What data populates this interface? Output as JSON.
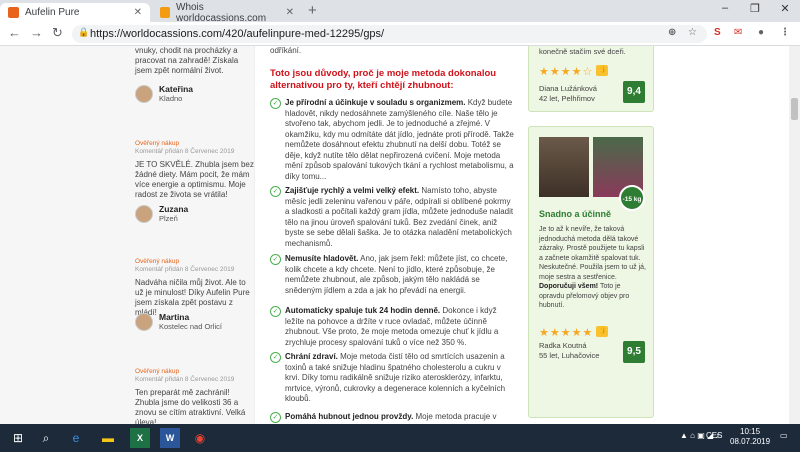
{
  "browser": {
    "tabs": [
      {
        "label": "Aufelin Pure",
        "active": true
      },
      {
        "label": "Whois worldocassions.com",
        "active": false
      }
    ],
    "url": "https://worldocassions.com/420/aufelinpure-med-12295/gps/"
  },
  "left_reviews": {
    "top_text": "vnuky, chodit na procházky a pracovat na zahradě! Získala jsem zpět normální život.",
    "p1_name": "Kateřina",
    "p1_city": "Kladno",
    "r2_meta": "Ověřený nákup",
    "r2_date": "Komentář přidán 8 Červenec 2019",
    "r2_text": "JE TO SKVĚLÉ. Zhubla jsem bez žádné diety. Mám pocit, že mám více energie a optimismu. Moje radost ze života se vrátila!",
    "p2_name": "Zuzana",
    "p2_city": "Plzeň",
    "r3_meta": "Ověřený nákup",
    "r3_date": "Komentář přidán 8 Červenec 2019",
    "r3_text": "Nadváha ničila můj život. Ale to už je minulost! Díky Aufelin Pure jsem získala zpět postavu z mládí!",
    "p3_name": "Martina",
    "p3_city": "Kostelec nad Orlicí",
    "r4_meta": "Ověřený nákup",
    "r4_date": "Komentář přidán 8 Červenec 2019",
    "r4_text": "Ten preparát mě zachránil! Zhubla jsme do velikosti 36 a znovu se cítím atraktivní. Velká úleva!"
  },
  "center": {
    "top_text": "odříkání.",
    "heading": "Toto jsou důvody, proč je moje metoda dokonalou alternativou pro ty, kteří chtějí zhubnout:",
    "items": [
      {
        "bold": "Je přírodní a účinkuje v souladu s organizmem.",
        "text": " Když budete hladovět, nikdy nedosáhnete zamýšleného cíle. Naše tělo je stvořeno tak, abychom jedli. Je to jednoduché a zřejmé. V okamžiku, kdy mu odmítáte dát jídlo, jednáte proti přírodě. Takže nemůžete dosáhnout efektu zhubnutí na delší dobu. Totéž se děje, když nutíte tělo dělat nepřirozená cvičení. Moje metoda mění způsob spalování tukových tkání a rychlost metabolismu, a díky tomu..."
      },
      {
        "bold": "Zajišťuje rychlý a velmi velký efekt.",
        "text": " Namísto toho, abyste měsíc jedli zeleninu vařenou v páře, odpírali si oblíbené pokrmy a sladkosti a počítali každý gram jídla, můžete jednoduše naladit tělo na jinou úroveň spalování tuků. Bez zvedání činek, aniž byste se sebe dělali šaška. Je to otázka naladění metabolických mechanismů."
      },
      {
        "bold": "Nemusíte hladovět.",
        "text": " Ano, jak jsem řekl: můžete jíst, co chcete, kolik chcete a kdy chcete. Není to jídlo, které způsobuje, že nemůžete zhubnout, ale způsob, jakým tělo nakládá se snědeným jídlem a zda a jak ho převádí na energii."
      },
      {
        "bold": "Automaticky spaluje tuk 24 hodin denně.",
        "text": " Dokonce i když ležíte na pohovce a držíte v ruce ovladač, můžete účinně zhubnout. Vše proto, že moje metoda omezuje chuť k jídlu a zrychluje procesy spalování tuků o více než 350 %."
      },
      {
        "bold": "Chrání zdraví.",
        "text": " Moje metoda čistí tělo od smrtících usazenin a toxinů a také snižuje hladinu špatného cholesterolu a cukru v krvi. Díky tomu radikálně snižuje riziko aterosklerózy, infarktu, mrtvice, výronů, cukrovky a degenerace kolenních a kyčelních kloubů."
      },
      {
        "bold": "Pomáhá hubnout jednou provždy.",
        "text": " Moje metoda pracuje v"
      }
    ]
  },
  "right": {
    "top_text": "konečně stačím své dceři.",
    "r1_stars": "★★★★☆",
    "r1_name": "Diana Lužánková",
    "r1_age": "42 let, Pelhřimov",
    "r1_score": "9,4",
    "badge": "-15 kg",
    "card2_title": "Snadno a účinně",
    "card2_text": "Je to až k nevíře, že taková jednoduchá metoda dělá takové zázraky. Prostě použijete tu kapsli a začnete okamžitě spalovat tuk. Neskutečné. Použila jsem to už já, moje sestra a sestřenice.",
    "card2_bold": "Doporučuji všem!",
    "card2_text2": " Toto je opravdu přelomový objev pro hubnutí.",
    "r2_stars": "★★★★★",
    "r2_name": "Radka Koutná",
    "r2_age": "55 let, Luhačovice",
    "r2_score": "9,5"
  },
  "taskbar": {
    "lang": "CES",
    "time": "10:15",
    "date": "08.07.2019"
  }
}
